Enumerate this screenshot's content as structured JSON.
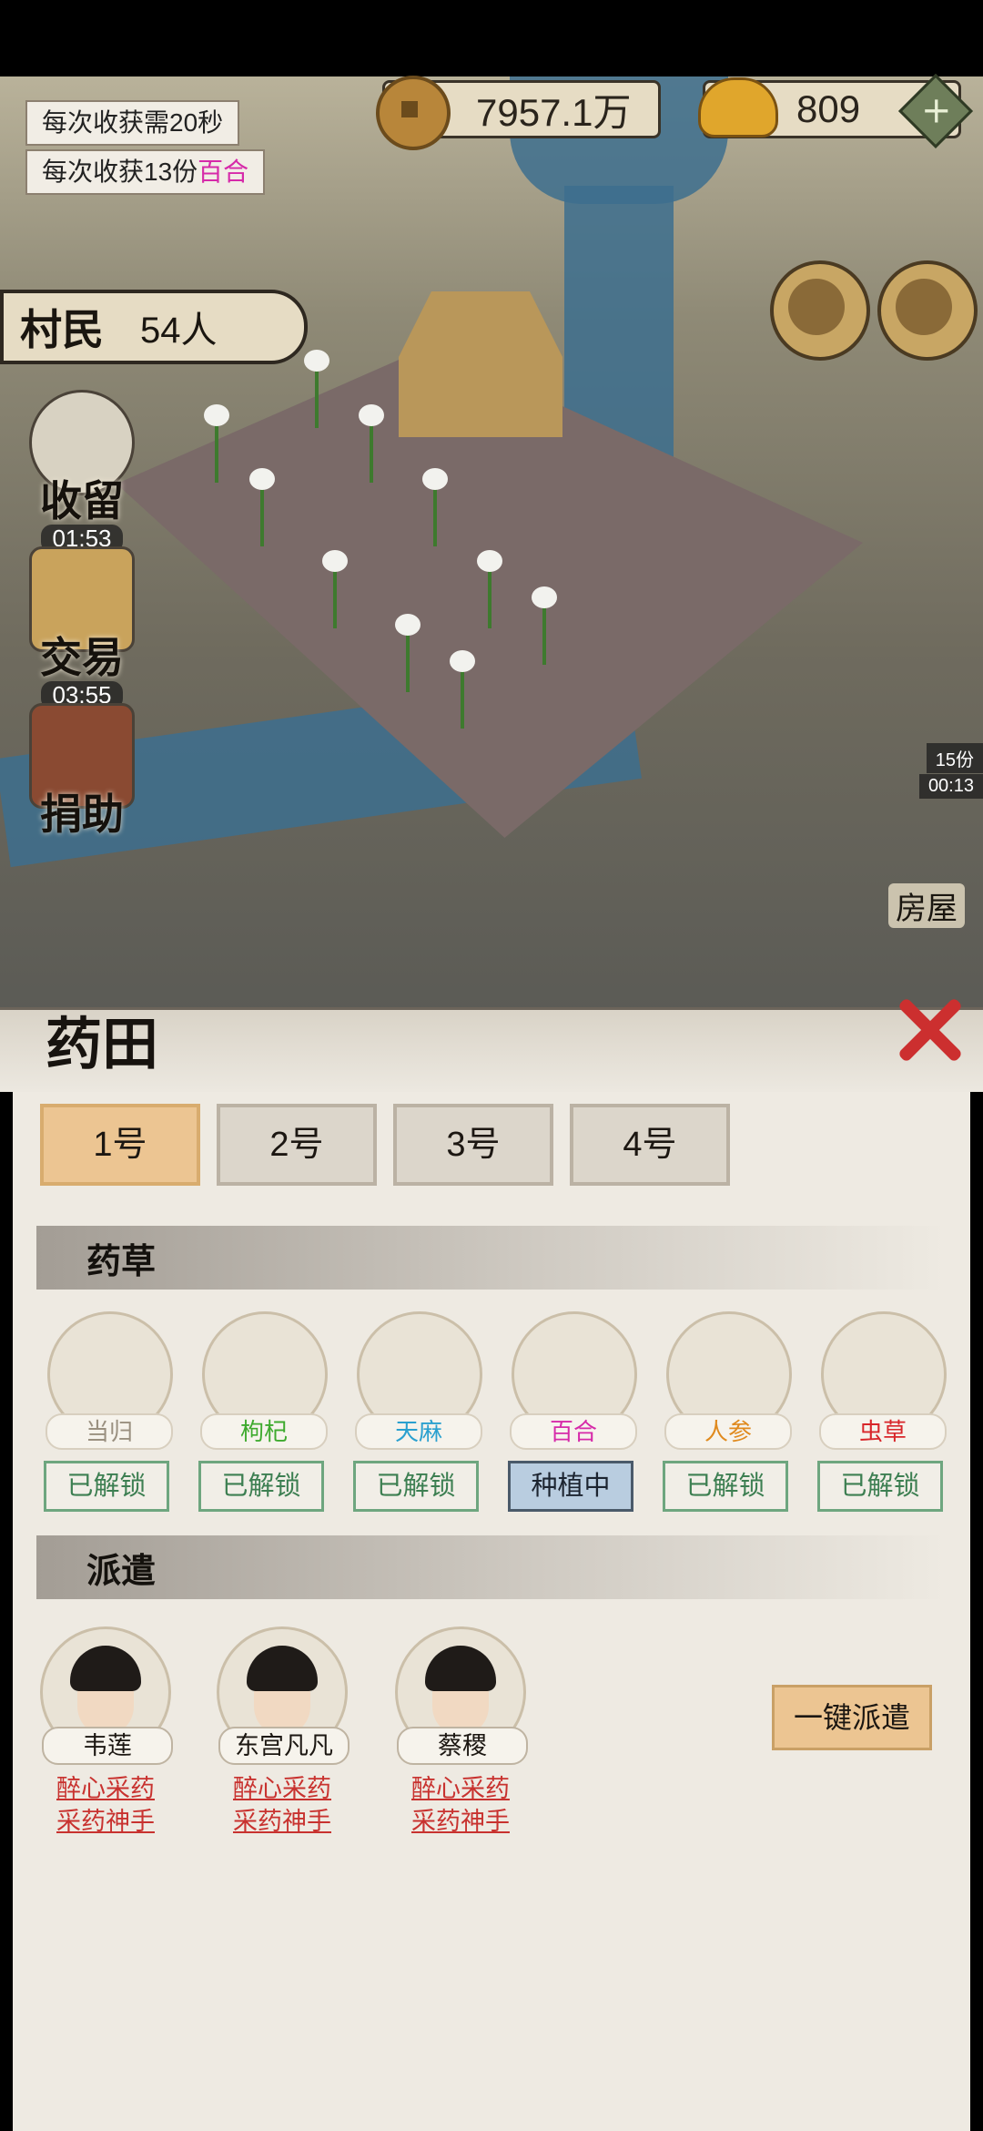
{
  "hud": {
    "harvest_interval": "每次收获需20秒",
    "harvest_amount_prefix": "每次收获13份",
    "harvest_amount_herb": "百合",
    "copper": "7957.1万",
    "ingot": "809",
    "add": "+"
  },
  "villager": {
    "label": "村民",
    "value": "54人"
  },
  "side": {
    "shouliu": {
      "label": "收留",
      "timer": "01:53"
    },
    "jiaoyi": {
      "label": "交易",
      "timer": "03:55"
    },
    "juanzhu": {
      "label": "捐助"
    }
  },
  "map_flags": {
    "count": "15份",
    "timer": "00:13",
    "house": "房屋"
  },
  "panel": {
    "title": "药田",
    "close": "×",
    "fields": [
      "1号",
      "2号",
      "3号",
      "4号"
    ],
    "active_field": 0,
    "herbs_section": "药草",
    "herbs": [
      {
        "name": "当归",
        "state": "已解锁",
        "color": "#9a9080"
      },
      {
        "name": "枸杞",
        "state": "已解锁",
        "color": "#3eaa2e"
      },
      {
        "name": "天麻",
        "state": "已解锁",
        "color": "#2aa0cf"
      },
      {
        "name": "百合",
        "state": "种植中",
        "color": "#d62aa9"
      },
      {
        "name": "人参",
        "state": "已解锁",
        "color": "#e08a1e"
      },
      {
        "name": "虫草",
        "state": "已解锁",
        "color": "#d8262a"
      }
    ],
    "dispatch_section": "派遣",
    "people": [
      {
        "name": "韦莲",
        "skill1": "醉心采药",
        "skill2": "采药神手"
      },
      {
        "name": "东宫凡凡",
        "skill1": "醉心采药",
        "skill2": "采药神手"
      },
      {
        "name": "蔡稷",
        "skill1": "醉心采药",
        "skill2": "采药神手"
      }
    ],
    "dispatch_all": "一键派遣"
  },
  "colors": {
    "accent_tab": "#ecc592",
    "herb_unlocked": "#3d7f52",
    "planting_bg": "#b9cde0",
    "skill_text": "#c8322f",
    "close": "#cc2f2f"
  }
}
